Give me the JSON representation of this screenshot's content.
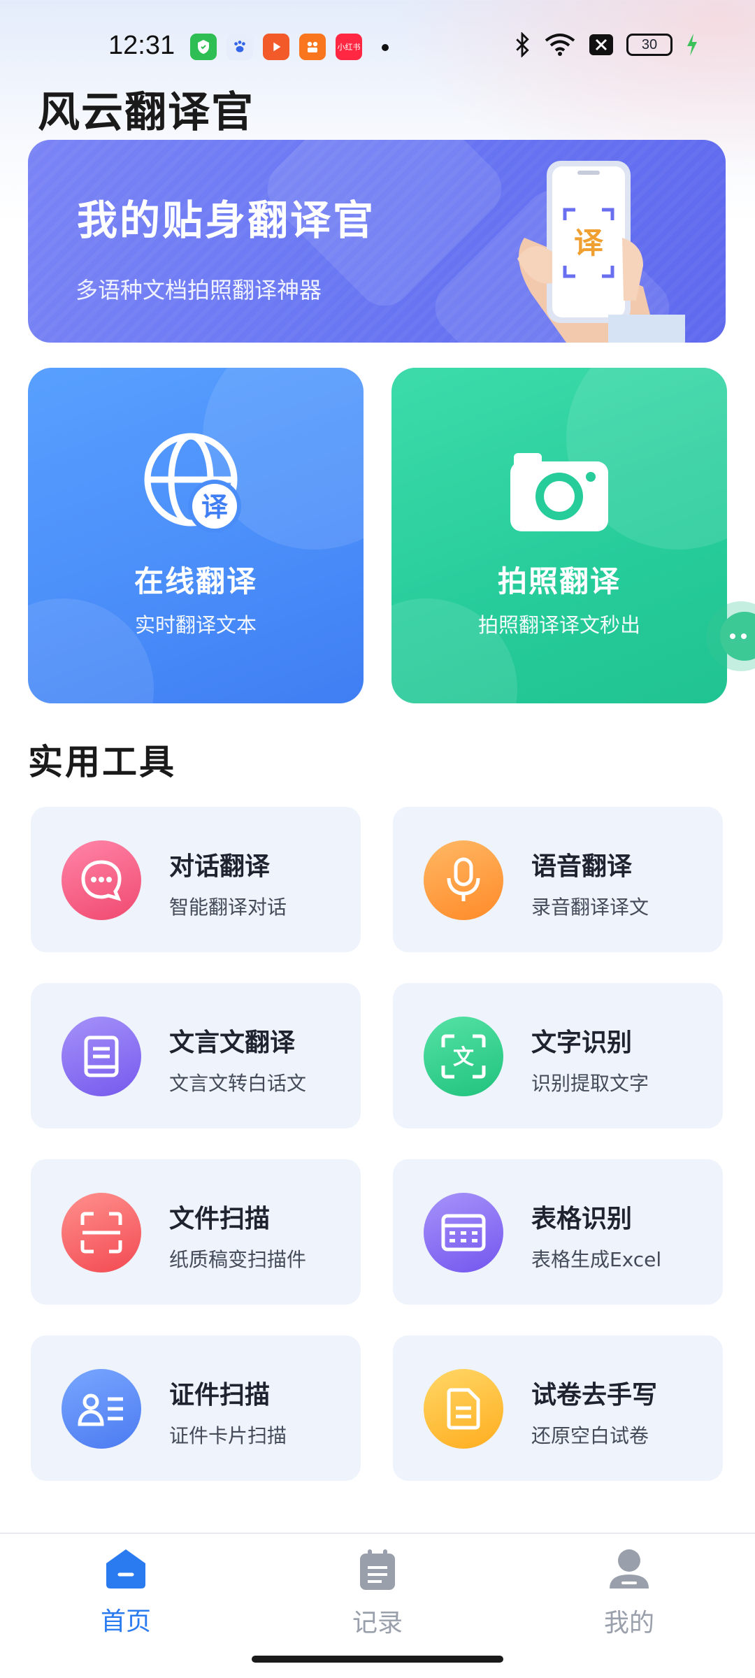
{
  "status_bar": {
    "time": "12:31",
    "battery": "30",
    "app_icons": [
      {
        "name": "wechat-like-icon",
        "color": "#2fbe53",
        "glyph": "✉"
      },
      {
        "name": "baidu-icon",
        "color": "#e9eefc",
        "glyph": "🐾"
      },
      {
        "name": "video-icon",
        "color": "#f25a2a",
        "glyph": "▶"
      },
      {
        "name": "kuaishou-icon",
        "color": "#f9761e",
        "glyph": "✿"
      },
      {
        "name": "xiaohongshu-icon",
        "color": "#ff2741",
        "glyph": "小红书"
      }
    ]
  },
  "app_title": "风云翻译官",
  "banner": {
    "title": "我的贴身翻译官",
    "subtitle": "多语种文档拍照翻译神器",
    "phone_glyph": "译"
  },
  "big_cards": [
    {
      "title": "在线翻译",
      "subtitle": "实时翻译文本",
      "badge": "译"
    },
    {
      "title": "拍照翻译",
      "subtitle": "拍照翻译译文秒出"
    }
  ],
  "section_title": "实用工具",
  "tools": [
    {
      "title": "对话翻译",
      "subtitle": "智能翻译对话",
      "icon": "chat-bubble-icon",
      "color_from": "#ff7aa0",
      "color_to": "#f24d77"
    },
    {
      "title": "语音翻译",
      "subtitle": "录音翻译译文",
      "icon": "microphone-icon",
      "color_from": "#ffb15a",
      "color_to": "#ff8a2a"
    },
    {
      "title": "文言文翻译",
      "subtitle": "文言文转白话文",
      "icon": "book-icon",
      "color_from": "#9d8cf7",
      "color_to": "#7b63ee"
    },
    {
      "title": "文字识别",
      "subtitle": "识别提取文字",
      "icon": "text-scan-icon",
      "color_from": "#4fe0a0",
      "color_to": "#23c57f",
      "glyph": "文"
    },
    {
      "title": "文件扫描",
      "subtitle": "纸质稿变扫描件",
      "icon": "document-scan-icon",
      "color_from": "#ff8a88",
      "color_to": "#f45257"
    },
    {
      "title": "表格识别",
      "subtitle": "表格生成Excel",
      "icon": "table-icon",
      "color_from": "#a08cf8",
      "color_to": "#7a5df0"
    },
    {
      "title": "证件扫描",
      "subtitle": "证件卡片扫描",
      "icon": "id-card-icon",
      "color_from": "#6fa0ff",
      "color_to": "#4f7ef2"
    },
    {
      "title": "试卷去手写",
      "subtitle": "还原空白试卷",
      "icon": "paper-icon",
      "color_from": "#ffd25a",
      "color_to": "#ffb224"
    }
  ],
  "bottom_nav": [
    {
      "label": "首页",
      "active": true,
      "color": "#2b7bf0"
    },
    {
      "label": "记录",
      "active": false,
      "color": "#9aa0ab"
    },
    {
      "label": "我的",
      "active": false,
      "color": "#9aa0ab"
    }
  ]
}
